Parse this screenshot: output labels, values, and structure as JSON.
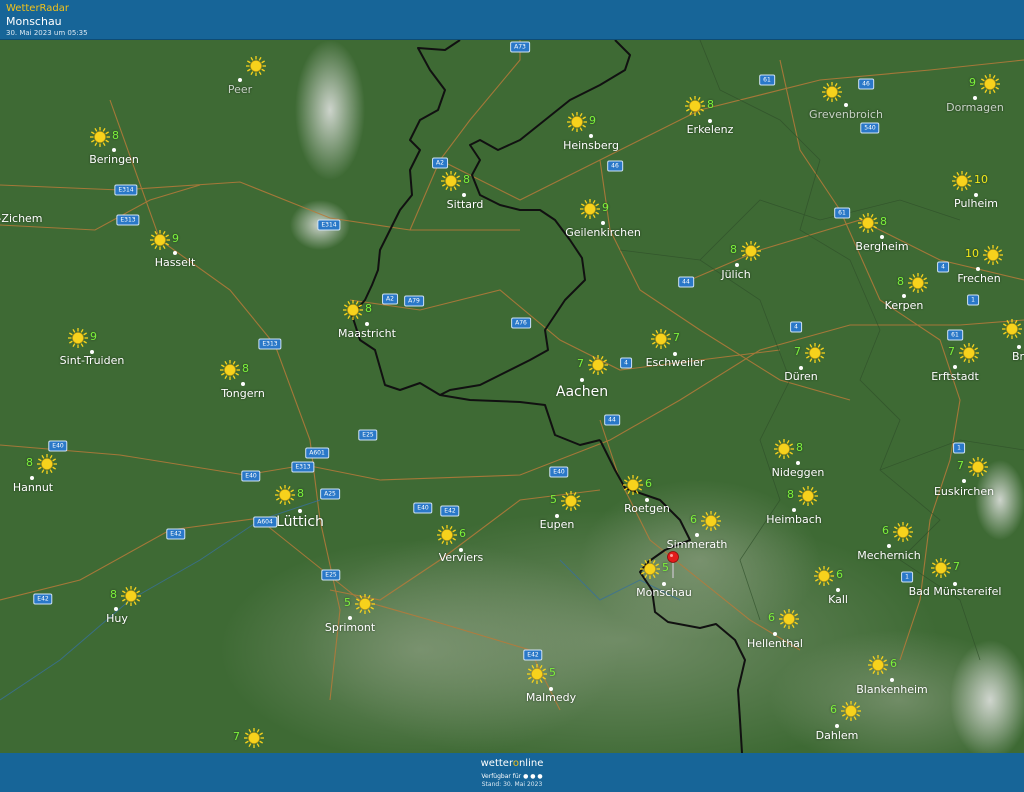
{
  "header": {
    "app_name": "WetterRadar",
    "location": "Monschau",
    "timestamp": "30. Mai 2023 um 05:35"
  },
  "footer": {
    "brand_prefix": "wetter",
    "brand_o": "o",
    "brand_suffix": "nline",
    "available_text": "Verfügbar für",
    "stand_text": "Stand: 30. Mai 2023"
  },
  "colors": {
    "bar": "#176598",
    "temp_green": "#7cf23b",
    "temp_yellow": "#f2e81a",
    "sun": "#f7d21c",
    "terrain": "#3e6a34",
    "border": "#111111",
    "road": "#b77a3a"
  },
  "icons": {
    "weather": "sun-icon",
    "marker": "location-pin-icon"
  },
  "map": {
    "locations": [
      {
        "name": "Peer",
        "temp": "",
        "faded": true
      },
      {
        "name": "Beringen",
        "temp": "8"
      },
      {
        "name": "-Zichem",
        "temp": ""
      },
      {
        "name": "Hasselt",
        "temp": "9"
      },
      {
        "name": "Sint-Truiden",
        "temp": "9"
      },
      {
        "name": "Tongern",
        "temp": "8"
      },
      {
        "name": "Hannut",
        "temp": "8"
      },
      {
        "name": "Huy",
        "temp": "8"
      },
      {
        "name": "Lüttich",
        "temp": "8",
        "big": true
      },
      {
        "name": "Sprimont",
        "temp": "5"
      },
      {
        "name": "Maastricht",
        "temp": "8"
      },
      {
        "name": "Sittard",
        "temp": "8"
      },
      {
        "name": "Heinsberg",
        "temp": "9"
      },
      {
        "name": "Geilenkirchen",
        "temp": "9"
      },
      {
        "name": "Erkelenz",
        "temp": "8"
      },
      {
        "name": "Grevenbroich",
        "temp": "",
        "faded": true
      },
      {
        "name": "Dormagen",
        "temp": "9",
        "faded": true
      },
      {
        "name": "Pulheim",
        "temp": "10",
        "yellow": true
      },
      {
        "name": "Bergheim",
        "temp": "8"
      },
      {
        "name": "Frechen",
        "temp": "10",
        "yellow": true
      },
      {
        "name": "Jülich",
        "temp": "8"
      },
      {
        "name": "Kerpen",
        "temp": "8"
      },
      {
        "name": "Br",
        "temp": ""
      },
      {
        "name": "Eschweiler",
        "temp": "7"
      },
      {
        "name": "Aachen",
        "temp": "7",
        "big": true
      },
      {
        "name": "Düren",
        "temp": "7"
      },
      {
        "name": "Erftstadt",
        "temp": "7"
      },
      {
        "name": "Verviers",
        "temp": "6"
      },
      {
        "name": "Eupen",
        "temp": "5"
      },
      {
        "name": "Roetgen",
        "temp": "6"
      },
      {
        "name": "Nideggen",
        "temp": "8"
      },
      {
        "name": "Heimbach",
        "temp": "8"
      },
      {
        "name": "Euskirchen",
        "temp": "7"
      },
      {
        "name": "Simmerath",
        "temp": "6"
      },
      {
        "name": "Monschau",
        "temp": "5"
      },
      {
        "name": "Mechernich",
        "temp": "6"
      },
      {
        "name": "Kall",
        "temp": "6"
      },
      {
        "name": "Bad Münstereifel",
        "temp": "7"
      },
      {
        "name": "Hellenthal",
        "temp": "6"
      },
      {
        "name": "Malmedy",
        "temp": "5"
      },
      {
        "name": "Blankenheim",
        "temp": "6"
      },
      {
        "name": "Dahlem",
        "temp": "6"
      },
      {
        "name": "",
        "temp": "7"
      }
    ],
    "road_shields": [
      "A73",
      "61",
      "46",
      "540",
      "A2",
      "46",
      "E314",
      "E313",
      "E314",
      "61",
      "4",
      "44",
      "A2",
      "A79",
      "A76",
      "4",
      "4",
      "61",
      "1",
      "E313",
      "44",
      "E40",
      "A601",
      "E25",
      "E313",
      "E40",
      "A25",
      "E40",
      "E40",
      "E42",
      "A604",
      "E42",
      "E25",
      "E42",
      "1",
      "1",
      "E42"
    ]
  }
}
